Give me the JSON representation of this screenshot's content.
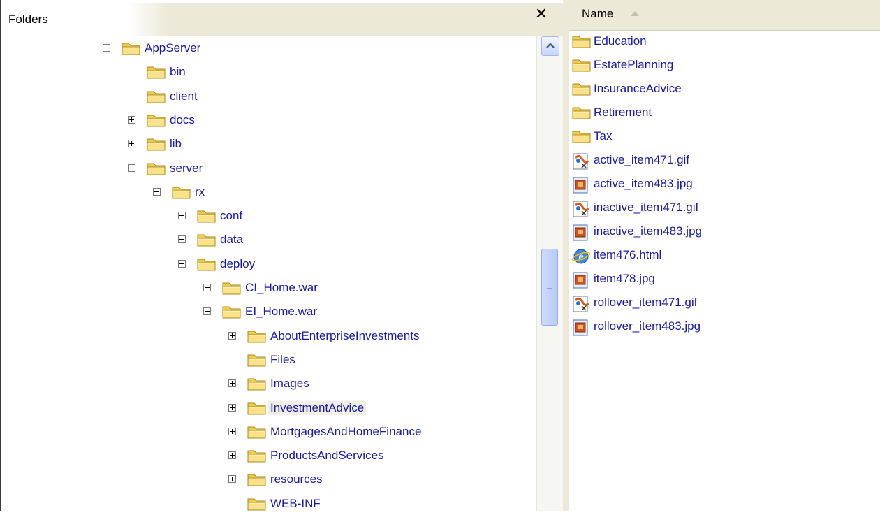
{
  "folders_pane": {
    "title": "Folders",
    "close_glyph": "✕"
  },
  "tree": {
    "items": [
      {
        "label": "AppServer",
        "expander": "minus"
      },
      {
        "label": "bin",
        "expander": "none"
      },
      {
        "label": "client",
        "expander": "none"
      },
      {
        "label": "docs",
        "expander": "plus"
      },
      {
        "label": "lib",
        "expander": "plus"
      },
      {
        "label": "server",
        "expander": "minus"
      },
      {
        "label": "rx",
        "expander": "minus"
      },
      {
        "label": "conf",
        "expander": "plus"
      },
      {
        "label": "data",
        "expander": "plus"
      },
      {
        "label": "deploy",
        "expander": "minus"
      },
      {
        "label": "CI_Home.war",
        "expander": "plus"
      },
      {
        "label": "EI_Home.war",
        "expander": "minus"
      },
      {
        "label": "AboutEnterpriseInvestments",
        "expander": "plus"
      },
      {
        "label": "Files",
        "expander": "none"
      },
      {
        "label": "Images",
        "expander": "plus"
      },
      {
        "label": "InvestmentAdvice",
        "expander": "plus",
        "selected": true
      },
      {
        "label": "MortgagesAndHomeFinance",
        "expander": "plus"
      },
      {
        "label": "ProductsAndServices",
        "expander": "plus"
      },
      {
        "label": "resources",
        "expander": "plus"
      },
      {
        "label": "WEB-INF",
        "expander": "none"
      }
    ]
  },
  "file_list": {
    "column_header": "Name",
    "sort": "ascending",
    "items": [
      {
        "name": "Education",
        "icon": "folder-icon"
      },
      {
        "name": "EstatePlanning",
        "icon": "folder-icon"
      },
      {
        "name": "InsuranceAdvice",
        "icon": "folder-icon"
      },
      {
        "name": "Retirement",
        "icon": "folder-icon"
      },
      {
        "name": "Tax",
        "icon": "folder-icon"
      },
      {
        "name": "active_item471.gif",
        "icon": "gif-file-icon"
      },
      {
        "name": "active_item483.jpg",
        "icon": "jpg-file-icon"
      },
      {
        "name": "inactive_item471.gif",
        "icon": "gif-file-icon"
      },
      {
        "name": "inactive_item483.jpg",
        "icon": "jpg-file-icon"
      },
      {
        "name": "item476.html",
        "icon": "html-file-icon"
      },
      {
        "name": "item478.jpg",
        "icon": "jpg-file-icon"
      },
      {
        "name": "rollover_item471.gif",
        "icon": "gif-file-icon"
      },
      {
        "name": "rollover_item483.jpg",
        "icon": "jpg-file-icon"
      }
    ]
  },
  "colors": {
    "link_text": "#1a1aa8",
    "pane_header": "#ece9d8",
    "selection": "#efefe6",
    "folder_yellow": "#f5d66c"
  }
}
